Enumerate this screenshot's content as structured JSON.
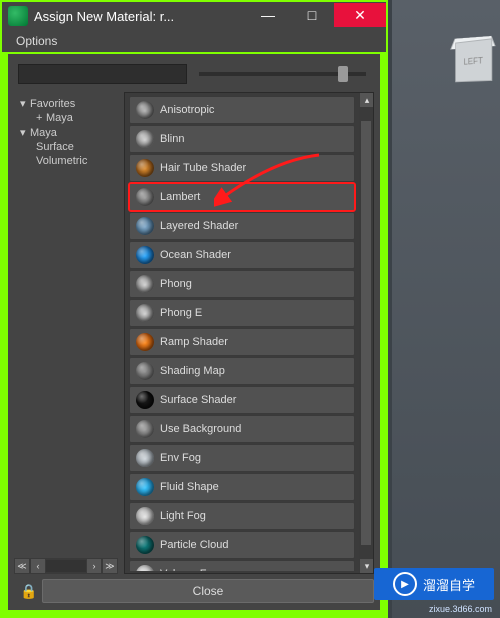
{
  "window": {
    "title": "Assign New Material: r...",
    "min": "—",
    "max": "□",
    "close": "✕"
  },
  "menubar": {
    "options": "Options"
  },
  "tree": {
    "favorites": "Favorites",
    "maya_fav": "Maya",
    "maya": "Maya",
    "surface": "Surface",
    "volumetric": "Volumetric"
  },
  "materials": [
    {
      "name": "Anisotropic",
      "c1": "#b0b0b0",
      "c2": "#3a3a3a",
      "hl": false
    },
    {
      "name": "Blinn",
      "c1": "#cfcfcf",
      "c2": "#555",
      "hl": false
    },
    {
      "name": "Hair Tube Shader",
      "c1": "#d98a2e",
      "c2": "#5a2e08",
      "hl": false
    },
    {
      "name": "Lambert",
      "c1": "#9a9a9a",
      "c2": "#4a4a4a",
      "hl": true
    },
    {
      "name": "Layered Shader",
      "c1": "#7fa8c9",
      "c2": "#2b4f6b",
      "hl": false
    },
    {
      "name": "Ocean Shader",
      "c1": "#2aa8ff",
      "c2": "#06386b",
      "hl": false
    },
    {
      "name": "Phong",
      "c1": "#d0d0d0",
      "c2": "#444",
      "hl": false
    },
    {
      "name": "Phong E",
      "c1": "#d0d0d0",
      "c2": "#444",
      "hl": false
    },
    {
      "name": "Ramp Shader",
      "c1": "#ff8a1f",
      "c2": "#7a2e00",
      "hl": false
    },
    {
      "name": "Shading Map",
      "c1": "#8a8a8a",
      "c2": "#555",
      "hl": false
    },
    {
      "name": "Surface Shader",
      "c1": "#1a1a1a",
      "c2": "#000",
      "hl": false
    },
    {
      "name": "Use Background",
      "c1": "#9a9a9a",
      "c2": "#555",
      "hl": false
    },
    {
      "name": "Env Fog",
      "c1": "#cfd6dc",
      "c2": "#6b7278",
      "hl": false
    },
    {
      "name": "Fluid Shape",
      "c1": "#39c6ff",
      "c2": "#0a5f8f",
      "hl": false
    },
    {
      "name": "Light Fog",
      "c1": "#e6e6e6",
      "c2": "#777",
      "hl": false
    },
    {
      "name": "Particle Cloud",
      "c1": "#0f7d7d",
      "c2": "#063838",
      "hl": false
    },
    {
      "name": "Volume Fog",
      "c1": "#f2f2f2",
      "c2": "#888",
      "hl": false
    }
  ],
  "footer": {
    "close": "Close"
  },
  "viewport": {
    "cube_label": "LEFT"
  },
  "watermark": {
    "text": "溜溜自学",
    "sub": "zixue.3d66.com"
  }
}
